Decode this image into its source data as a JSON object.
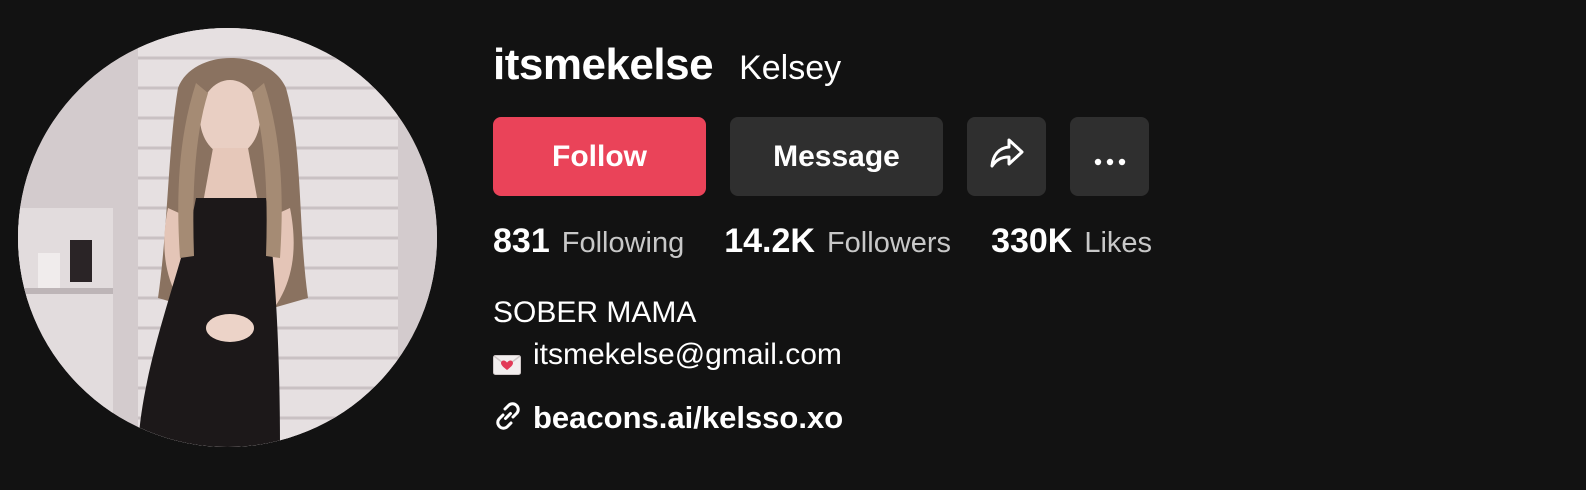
{
  "profile": {
    "username": "itsmekelse",
    "nickname": "Kelsey"
  },
  "actions": {
    "follow_label": "Follow",
    "message_label": "Message",
    "share_icon": "share-arrow-icon",
    "more_icon": "more-horizontal-icon"
  },
  "stats": {
    "following_count": "831",
    "following_label": "Following",
    "followers_count": "14.2K",
    "followers_label": "Followers",
    "likes_count": "330K",
    "likes_label": "Likes"
  },
  "bio": {
    "line1": "SOBER MAMA",
    "email_icon": "love-letter-icon",
    "email": "itsmekelse@gmail.com"
  },
  "link": {
    "icon": "link-icon",
    "text": "beacons.ai/kelsso.xo"
  },
  "colors": {
    "background": "#121212",
    "follow_button": "#ea4359",
    "secondary_button": "#2f2f2f",
    "muted_text": "#c8c8c8"
  }
}
